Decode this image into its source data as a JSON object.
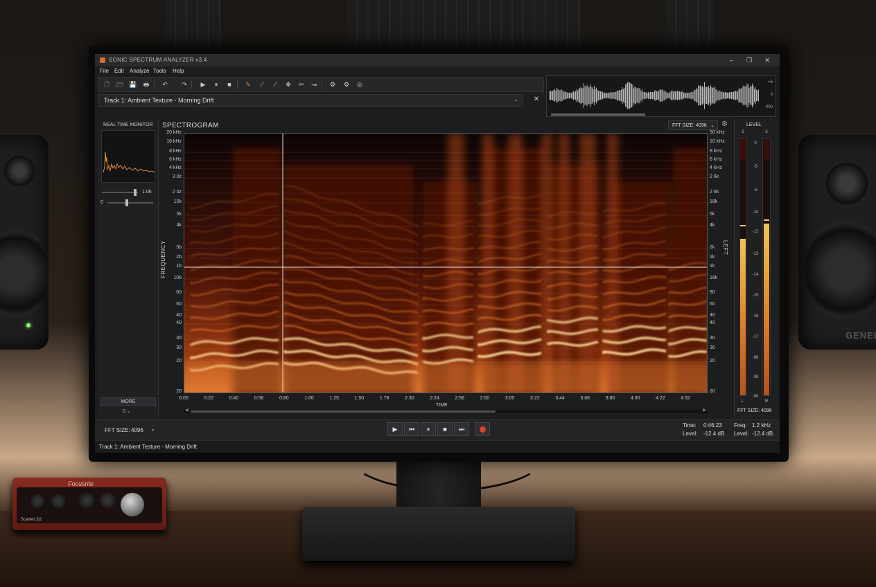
{
  "app": {
    "title": "SONIC SPECTRUM ANALYZER v3.4",
    "window_controls": [
      "–",
      "❐",
      "✕"
    ]
  },
  "menu": [
    "File",
    "Edit",
    "Analyze",
    "Tools",
    "Help"
  ],
  "toolbar": {
    "icons": [
      "new-file-icon",
      "open-folder-icon",
      "save-icon",
      "print-icon",
      "undo-icon",
      "redo-icon",
      "play-icon",
      "pause-icon",
      "stop-icon",
      "brush-icon",
      "line-tool-icon",
      "pen-icon",
      "marker-icon",
      "scissors-icon",
      "lasso-icon",
      "settings-icon",
      "filter-icon",
      "export-icon"
    ],
    "glyphs": [
      "🗋",
      "🗁",
      "💾",
      "🖶",
      "↶",
      "↷",
      "▶",
      "⏸",
      "■",
      "✎",
      "⟋",
      "⟋",
      "✥",
      "✂",
      "↝",
      "⚙",
      "⚙",
      "◎"
    ]
  },
  "track": {
    "name": "Track 1: Ambient Texture - Morning Drift",
    "chevron": "⌄",
    "close": "✕"
  },
  "overview": {
    "db_labels": [
      "+6",
      "0",
      "-000"
    ]
  },
  "left_panel": {
    "title": "REAL TIME MONITOR",
    "slider1_value": "1.06",
    "slider2_value": "0",
    "more_label": "MORE",
    "bottom_label": "0 ⌄"
  },
  "spectrogram": {
    "title": "SPECTROGRAM",
    "fft_label": "FFT SIZE:",
    "fft_value": "4096",
    "chevron": "⌄",
    "y_axis_label_left": "FREQUENCY",
    "y_axis_label_right": "LEFT",
    "x_axis_label": "TIME",
    "y_ticks_left": [
      "20 kHz",
      "16 kHz",
      "8 kHz",
      "6 kHz",
      "4 kHz",
      "3 0z",
      "2 0z",
      "10k",
      "5k",
      "4k",
      "3b",
      "2b",
      "1b",
      "106",
      "80",
      "50",
      "40",
      "40",
      "30",
      "30",
      "20",
      "20"
    ],
    "y_ticks_right": [
      "50 kHz",
      "10 kHz",
      "8 kHz",
      "6 kHz",
      "4 kHz",
      "2 6k",
      "2 6k",
      "18k",
      "5k",
      "4k",
      "2k",
      "2k",
      "1k",
      "16k",
      "80",
      "60",
      "40",
      "40",
      "30",
      "30",
      "20",
      "20"
    ],
    "x_ticks": [
      "0:00",
      "0:22",
      "0:40",
      "0:56",
      "0:80",
      "1:00",
      "1:25",
      "1:50",
      "1:78",
      "2:30",
      "2:24",
      "2:56",
      "2:60",
      "3:00",
      "3:22",
      "3:44",
      "3:66",
      "3:80",
      "4:00",
      "4:22",
      "4:32"
    ],
    "cursor_time": "0:80",
    "cursor_freq": "1k",
    "colormap": [
      "#0c0505",
      "#4a1408",
      "#9a3a10",
      "#e07a30",
      "#ffd79a"
    ]
  },
  "level": {
    "title": "LEVEL",
    "top_labels": [
      "5",
      "5"
    ],
    "scale": [
      "0",
      "-5",
      "-5",
      "-10",
      "-12",
      "-13",
      "-14",
      "-15",
      "-16",
      "-17",
      "-98",
      "-39",
      "-90"
    ],
    "left_fill": 0.61,
    "right_fill": 0.67,
    "left_peak": 0.66,
    "right_peak": 0.68,
    "channel_left": "L",
    "channel_right": "R",
    "fft_text": "FFT SIZE: 4096"
  },
  "bottom": {
    "fft_label": "FFT SIZE:",
    "fft_value": "4096",
    "chevron": "⌄",
    "transport_glyphs": [
      "▶",
      "⏮",
      "⏸",
      "■",
      "⏭"
    ],
    "time_label": "Time:",
    "time_value": "0:46.23",
    "level_label": "Level:",
    "level_value": "-12.4 dB",
    "freq_label": "Freq:",
    "freq_value": "1.2 kHz",
    "level2_label": "Level:",
    "level2_value": "-12.4 dB"
  },
  "status": {
    "text": "Track 1: Ambient Testure - Morning Drift"
  },
  "props": {
    "speaker_brand": "GENELE",
    "interface_brand": "Focusrite",
    "interface_model": "Scarlett 2i2"
  }
}
